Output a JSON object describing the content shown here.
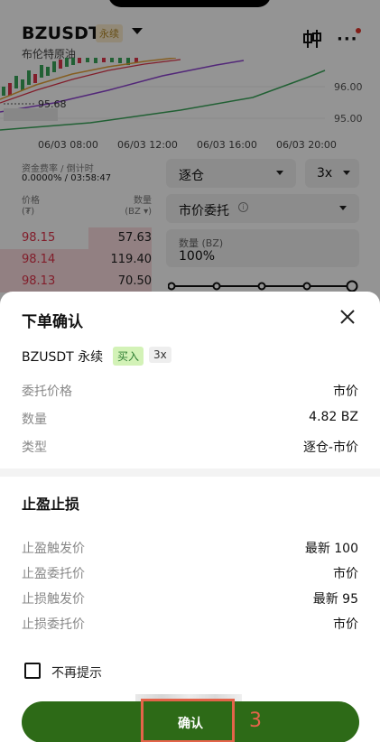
{
  "header": {
    "symbol": "BZUSDT",
    "badge": "永续",
    "subtitle": "布伦特原油"
  },
  "chart": {
    "price_labels": [
      "96.00",
      "95.00"
    ],
    "last_price": "95.68",
    "time_labels": [
      "06/03 08:00",
      "06/03 12:00",
      "06/03 16:00",
      "06/03 20:00"
    ]
  },
  "funding": {
    "label": "资金费率 / 倒计时",
    "value": "0.0000% / 03:58:47"
  },
  "orderbook": {
    "price_header": "价格",
    "price_unit": "(₮)",
    "qty_header": "数量",
    "qty_unit": "(BZ ▾)",
    "rows": [
      {
        "price": "98.15",
        "qty": "57.63"
      },
      {
        "price": "98.14",
        "qty": "119.40"
      },
      {
        "price": "98.13",
        "qty": "70.50"
      }
    ]
  },
  "form": {
    "margin_mode": "逐仓",
    "leverage": "3x",
    "order_type": "市价委托",
    "order_type_info_icon": "info-icon",
    "qty_label": "数量 (BZ)",
    "qty_value": "100%"
  },
  "modal": {
    "title": "下单确认",
    "pair": "BZUSDT 永续",
    "side": "买入",
    "leverage": "3x",
    "rows": [
      {
        "label": "委托价格",
        "value": "市价"
      },
      {
        "label": "数量",
        "value": "4.82 BZ"
      },
      {
        "label": "类型",
        "value": "逐仓-市价"
      }
    ],
    "tpsl_title": "止盈止损",
    "tpsl_rows": [
      {
        "label": "止盈触发价",
        "value": "最新 100"
      },
      {
        "label": "止盈委托价",
        "value": "市价"
      },
      {
        "label": "止损触发价",
        "value": "最新 95"
      },
      {
        "label": "止损委托价",
        "value": "市价"
      }
    ],
    "dont_show_again": "不再提示",
    "confirm_label": "确认"
  },
  "annotation": {
    "step": "3"
  },
  "colors": {
    "confirm": "#2d6a17",
    "ask": "#e0344a",
    "buy_badge_bg": "#d3f2b7",
    "highlight": "#e4644a"
  }
}
